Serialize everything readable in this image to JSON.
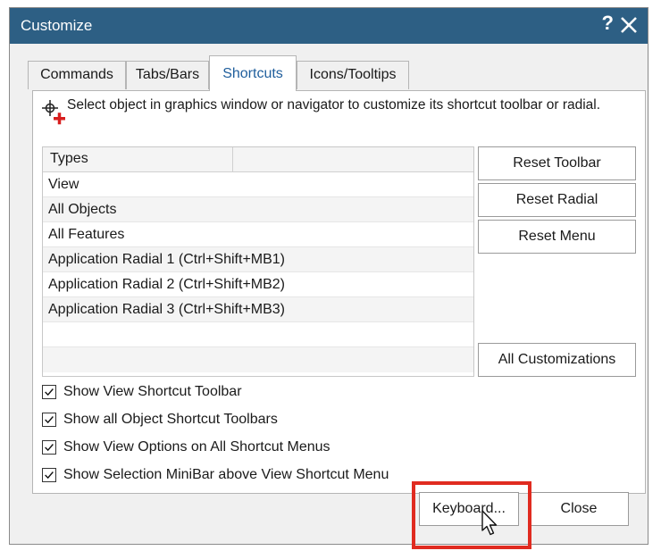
{
  "window": {
    "title": "Customize",
    "help_label": "?"
  },
  "tabs": [
    {
      "label": "Commands"
    },
    {
      "label": "Tabs/Bars"
    },
    {
      "label": "Shortcuts",
      "active": true
    },
    {
      "label": "Icons/Tooltips"
    }
  ],
  "instruction": "Select object in graphics window or navigator to customize its shortcut toolbar or radial.",
  "types_list": {
    "header": "Types",
    "rows": [
      "View",
      "All Objects",
      "All Features",
      "Application Radial 1 (Ctrl+Shift+MB1)",
      "Application Radial 2 (Ctrl+Shift+MB2)",
      "Application Radial 3 (Ctrl+Shift+MB3)"
    ]
  },
  "side_buttons": {
    "reset_toolbar": "Reset Toolbar",
    "reset_radial": "Reset Radial",
    "reset_menu": "Reset Menu",
    "all_customizations": "All Customizations"
  },
  "options": [
    {
      "label": "Show View Shortcut Toolbar",
      "checked": true
    },
    {
      "label": "Show all Object Shortcut Toolbars",
      "checked": true
    },
    {
      "label": "Show View Options on All Shortcut Menus",
      "checked": true
    },
    {
      "label": "Show Selection MiniBar above View Shortcut Menu",
      "checked": true
    }
  ],
  "footer": {
    "keyboard_label": "Keyboard...",
    "close_label": "Close"
  },
  "colors": {
    "titlebar": "#2d5f84",
    "active_tab_text": "#1f5e9c",
    "highlight": "#e02b20"
  }
}
